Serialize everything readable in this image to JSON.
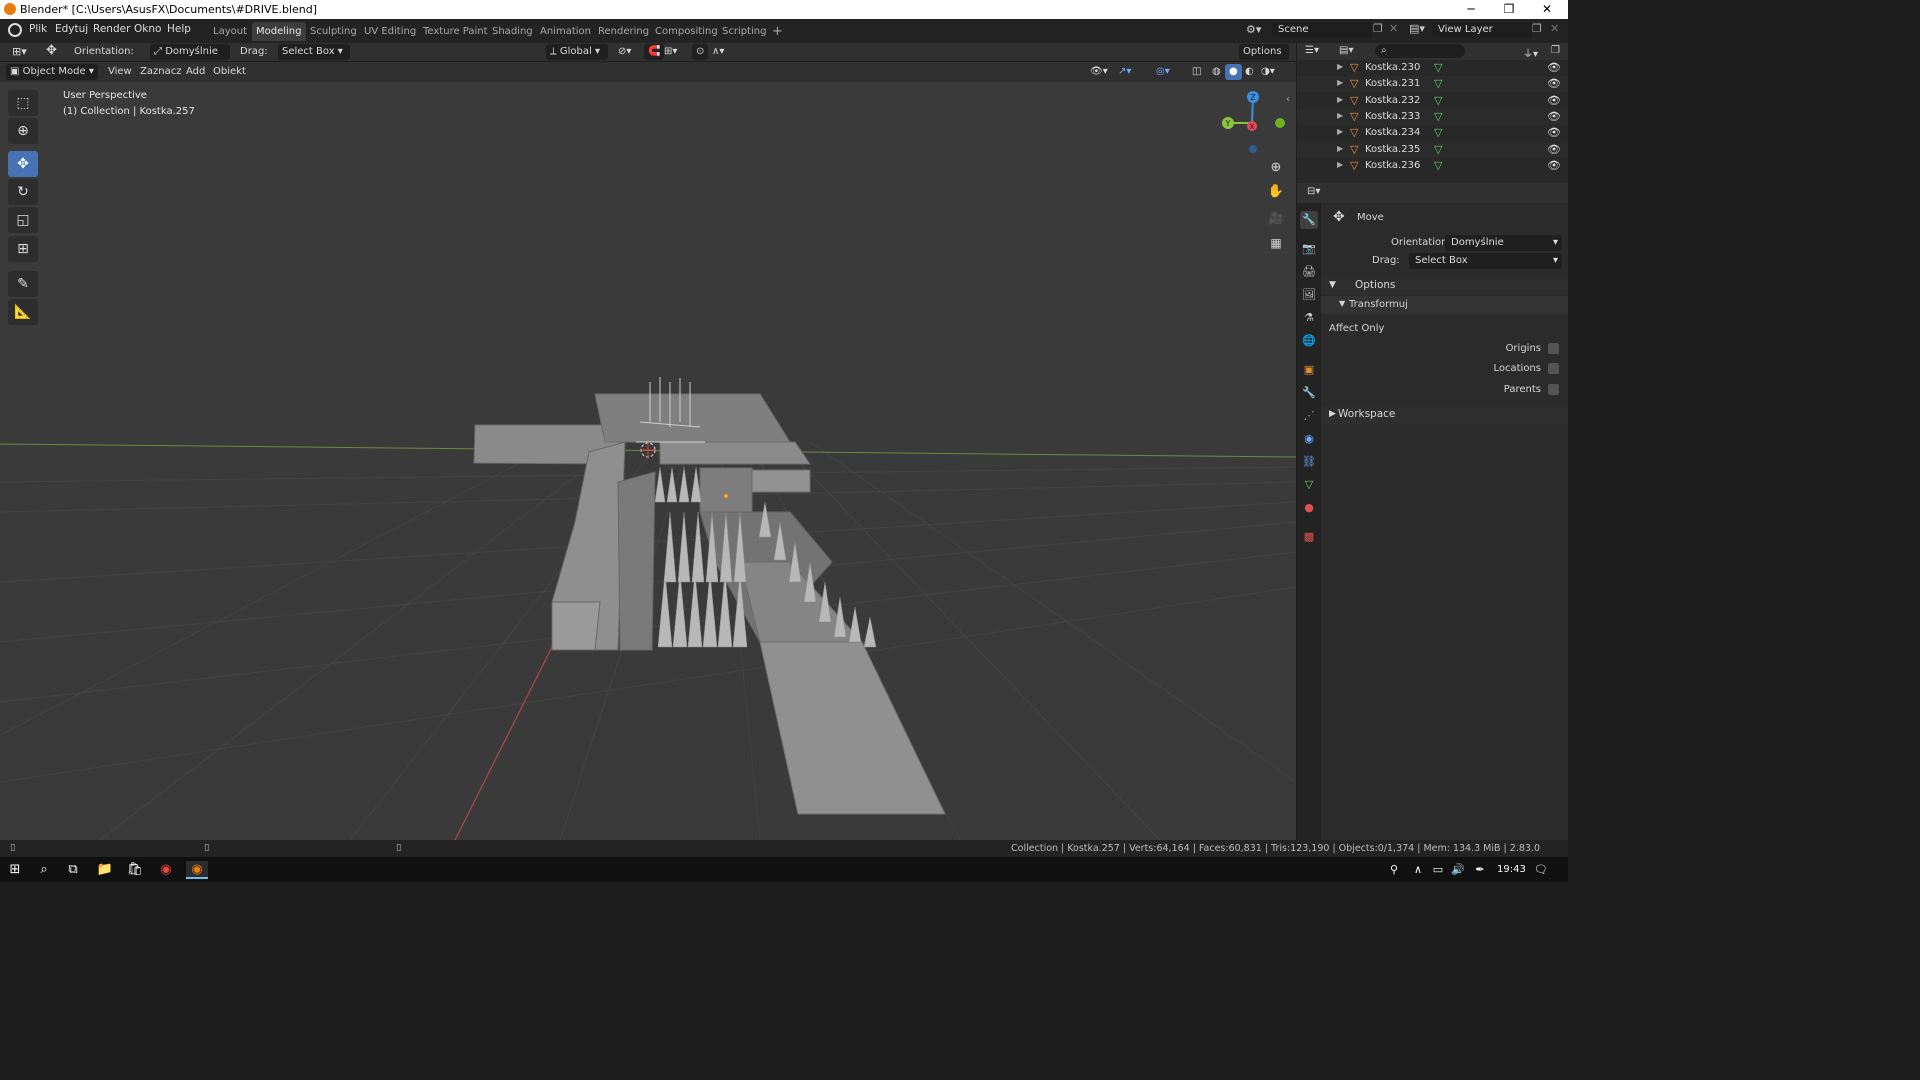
{
  "window": {
    "title": "Blender* [C:\\Users\\AsusFX\\Documents\\#DRIVE.blend]"
  },
  "menu": {
    "items": [
      "Plik",
      "Edytuj",
      "Render",
      "Okno",
      "Help"
    ]
  },
  "workspaces": {
    "tabs": [
      "Layout",
      "Modeling",
      "Sculpting",
      "UV Editing",
      "Texture Paint",
      "Shading",
      "Animation",
      "Rendering",
      "Compositing",
      "Scripting"
    ],
    "active": "Modeling"
  },
  "scene": {
    "name": "Scene",
    "view_layer": "View Layer"
  },
  "tool_header": {
    "orientation_label": "Orientation:",
    "orientation_value": "Domyślnie",
    "drag_label": "Drag:",
    "drag_value": "Select Box",
    "transform_orientation": "Global",
    "options_label": "Options"
  },
  "view_header": {
    "mode": "Object Mode",
    "view": "View",
    "select": "Zaznacz",
    "add": "Add",
    "object": "Obiekt"
  },
  "viewport": {
    "perspective": "User Perspective",
    "collection_info": "(1) Collection | Kostka.257",
    "gizmo": {
      "x": "X",
      "y": "Y",
      "z": "Z"
    }
  },
  "outliner": {
    "items": [
      "Kostka.230",
      "Kostka.231",
      "Kostka.232",
      "Kostka.233",
      "Kostka.234",
      "Kostka.235",
      "Kostka.236"
    ]
  },
  "properties": {
    "tool_name": "Move",
    "orientation_label": "Orientation",
    "orientation_value": "Domyślnie",
    "drag_label": "Drag:",
    "drag_value": "Select Box",
    "options_panel": "Options",
    "transform_subpanel": "Transformuj",
    "affect_only": "Affect Only",
    "origins": "Origins",
    "locations": "Locations",
    "parents": "Parents",
    "workspace_panel": "Workspace"
  },
  "statusbar": {
    "stats": "Collection | Kostka.257 | Verts:64,164 | Faces:60,831 | Tris:123,190 | Objects:0/1,374 | Mem: 134.3 MiB | 2.83.0"
  },
  "taskbar": {
    "time": "19:43"
  },
  "colors": {
    "accent": "#4772b3",
    "blender_orange": "#e87d0d",
    "x_axis": "#e04b5b",
    "y_axis": "#8bc540",
    "z_axis": "#3b8ee0"
  }
}
